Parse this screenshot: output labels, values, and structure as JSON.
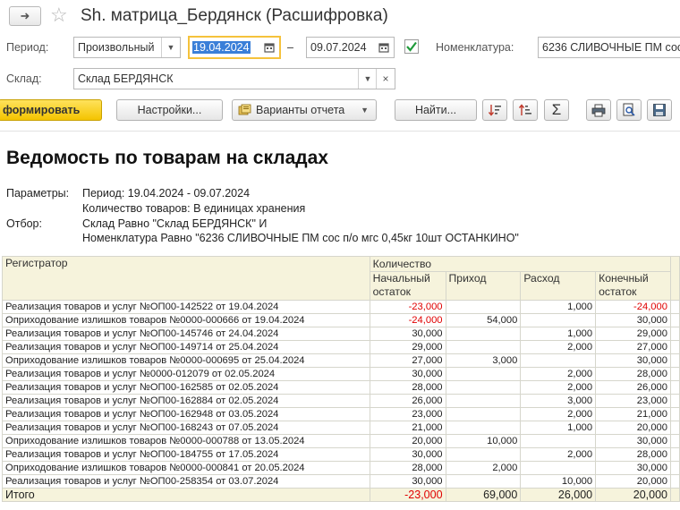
{
  "window": {
    "title": "Sh. матрица_Бердянск (Расшифровка)"
  },
  "filters": {
    "period_label": "Период:",
    "period_type": "Произвольный",
    "date_from": "19.04.2024",
    "date_separator": "–",
    "date_to": "09.07.2024",
    "nomenclature_label": "Номенклатура:",
    "nomenclature_value": "6236 СЛИВОЧНЫЕ ПМ сос п/о мгс 0,45кг 10шт  ОСТАНКИНО",
    "warehouse_label": "Склад:",
    "warehouse_value": "Склад БЕРДЯНСК",
    "clear_glyph": "×"
  },
  "toolbar": {
    "generate_label": "формировать",
    "settings_label": "Настройки...",
    "variants_label": "Варианты отчета",
    "find_label": "Найти..."
  },
  "report": {
    "title": "Ведомость по товарам на складах",
    "params_label": "Параметры:",
    "params_line1": "Период: 19.04.2024 - 09.07.2024",
    "params_line2": "Количество товаров: В единицах хранения",
    "filter_label": "Отбор:",
    "filter_line1": "Склад Равно \"Склад БЕРДЯНСК\" И",
    "filter_line2": "Номенклатура Равно \"6236 СЛИВОЧНЫЕ ПМ сос п/о мгс 0,45кг 10шт  ОСТАНКИНО\""
  },
  "table": {
    "col_registrar": "Регистратор",
    "col_group": "Количество",
    "col_start": "Начальный остаток",
    "col_in": "Приход",
    "col_out": "Расход",
    "col_end": "Конечный остаток",
    "rows": [
      {
        "reg": "Реализация товаров и услуг №ОП00-142522 от 19.04.2024",
        "start": "-23,000",
        "in": "",
        "out": "1,000",
        "end": "-24,000"
      },
      {
        "reg": "Оприходование излишков товаров №0000-000666 от 19.04.2024",
        "start": "-24,000",
        "in": "54,000",
        "out": "",
        "end": "30,000"
      },
      {
        "reg": "Реализация товаров и услуг №ОП00-145746 от 24.04.2024",
        "start": "30,000",
        "in": "",
        "out": "1,000",
        "end": "29,000"
      },
      {
        "reg": "Реализация товаров и услуг №ОП00-149714 от 25.04.2024",
        "start": "29,000",
        "in": "",
        "out": "2,000",
        "end": "27,000"
      },
      {
        "reg": "Оприходование излишков товаров №0000-000695 от 25.04.2024",
        "start": "27,000",
        "in": "3,000",
        "out": "",
        "end": "30,000"
      },
      {
        "reg": "Реализация товаров и услуг №0000-012079 от 02.05.2024",
        "start": "30,000",
        "in": "",
        "out": "2,000",
        "end": "28,000"
      },
      {
        "reg": "Реализация товаров и услуг №ОП00-162585 от 02.05.2024",
        "start": "28,000",
        "in": "",
        "out": "2,000",
        "end": "26,000"
      },
      {
        "reg": "Реализация товаров и услуг №ОП00-162884 от 02.05.2024",
        "start": "26,000",
        "in": "",
        "out": "3,000",
        "end": "23,000"
      },
      {
        "reg": "Реализация товаров и услуг №ОП00-162948 от 03.05.2024",
        "start": "23,000",
        "in": "",
        "out": "2,000",
        "end": "21,000"
      },
      {
        "reg": "Реализация товаров и услуг №ОП00-168243 от 07.05.2024",
        "start": "21,000",
        "in": "",
        "out": "1,000",
        "end": "20,000"
      },
      {
        "reg": "Оприходование излишков товаров №0000-000788 от 13.05.2024",
        "start": "20,000",
        "in": "10,000",
        "out": "",
        "end": "30,000"
      },
      {
        "reg": "Реализация товаров и услуг №ОП00-184755 от 17.05.2024",
        "start": "30,000",
        "in": "",
        "out": "2,000",
        "end": "28,000"
      },
      {
        "reg": "Оприходование излишков товаров №0000-000841 от 20.05.2024",
        "start": "28,000",
        "in": "2,000",
        "out": "",
        "end": "30,000"
      },
      {
        "reg": "Реализация товаров и услуг №ОП00-258354 от 03.07.2024",
        "start": "30,000",
        "in": "",
        "out": "10,000",
        "end": "20,000"
      }
    ],
    "total": {
      "label": "Итого",
      "start": "-23,000",
      "in": "69,000",
      "out": "26,000",
      "end": "20,000"
    }
  },
  "colors": {
    "negative": "#e00000",
    "header_bg": "#f6f3dc",
    "generate_button": "#f4c400",
    "date_focus": "#f5c23c"
  }
}
